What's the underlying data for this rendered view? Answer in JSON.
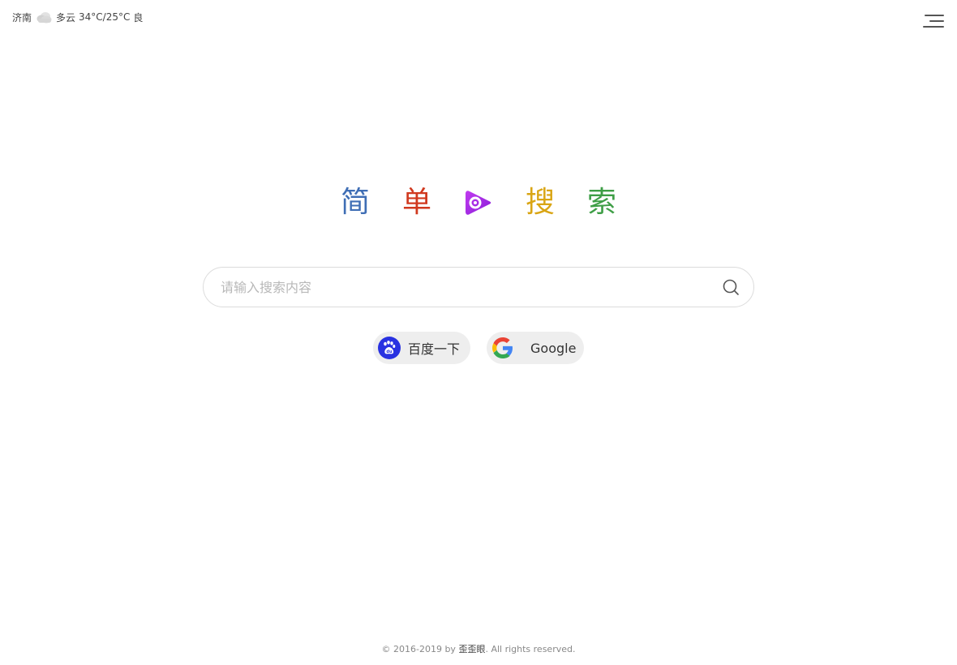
{
  "weather": {
    "city": "济南",
    "icon": "cloud-icon",
    "condition": "多云",
    "temperature": "34°C/25°C",
    "air_quality": "良"
  },
  "menu": {
    "icon": "hamburger-menu-icon"
  },
  "logo": {
    "chars": [
      "简",
      "单",
      "搜",
      "索"
    ],
    "colors": [
      "#3f6eb5",
      "#d0391f",
      "#d9a514",
      "#3e9e46"
    ],
    "mark_icon": "play-logo-icon",
    "mark_color": "#a028e0"
  },
  "search": {
    "placeholder": "请输入搜索内容",
    "value": "",
    "icon": "search-icon"
  },
  "engines": [
    {
      "label": "百度一下",
      "icon": "baidu-paw-icon",
      "color": "#2932e1"
    },
    {
      "label": "Google",
      "icon": "google-g-icon"
    }
  ],
  "footer": {
    "prefix": "© 2016-2019 by",
    "author": "歪歪眼",
    "suffix": ". All rights reserved."
  }
}
